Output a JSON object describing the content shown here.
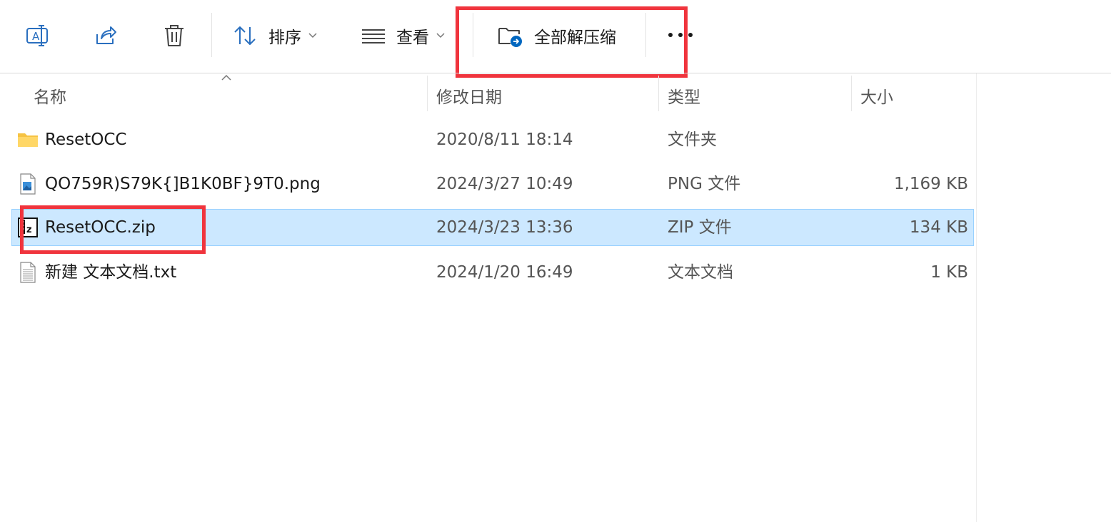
{
  "toolbar": {
    "rename_icon": "rename-icon",
    "share_icon": "share-icon",
    "delete_icon": "trash-icon",
    "sort_label": "排序",
    "view_label": "查看",
    "extract_all_label": "全部解压缩",
    "more_icon": "more-dots-icon"
  },
  "columns": {
    "name": "名称",
    "modified": "修改日期",
    "type": "类型",
    "size": "大小"
  },
  "files": [
    {
      "name": "ResetOCC",
      "modified": "2020/8/11 18:14",
      "type": "文件夹",
      "size": "",
      "icon": "folder-icon",
      "selected": false
    },
    {
      "name": "QO759R)S79K{]B1K0BF}9T0.png",
      "modified": "2024/3/27 10:49",
      "type": "PNG 文件",
      "size": "1,169 KB",
      "icon": "image-file-icon",
      "selected": false
    },
    {
      "name": "ResetOCC.zip",
      "modified": "2024/3/23 13:36",
      "type": "ZIP 文件",
      "size": "134 KB",
      "icon": "zip-file-icon",
      "selected": true
    },
    {
      "name": "新建 文本文档.txt",
      "modified": "2024/1/20 16:49",
      "type": "文本文档",
      "size": "1 KB",
      "icon": "text-file-icon",
      "selected": false
    }
  ],
  "colors": {
    "accent": "#0067c0",
    "selection_bg": "#cce8ff",
    "selection_border": "#99d1ff",
    "highlight_box": "#f0343d",
    "folder": "#f6c343"
  }
}
